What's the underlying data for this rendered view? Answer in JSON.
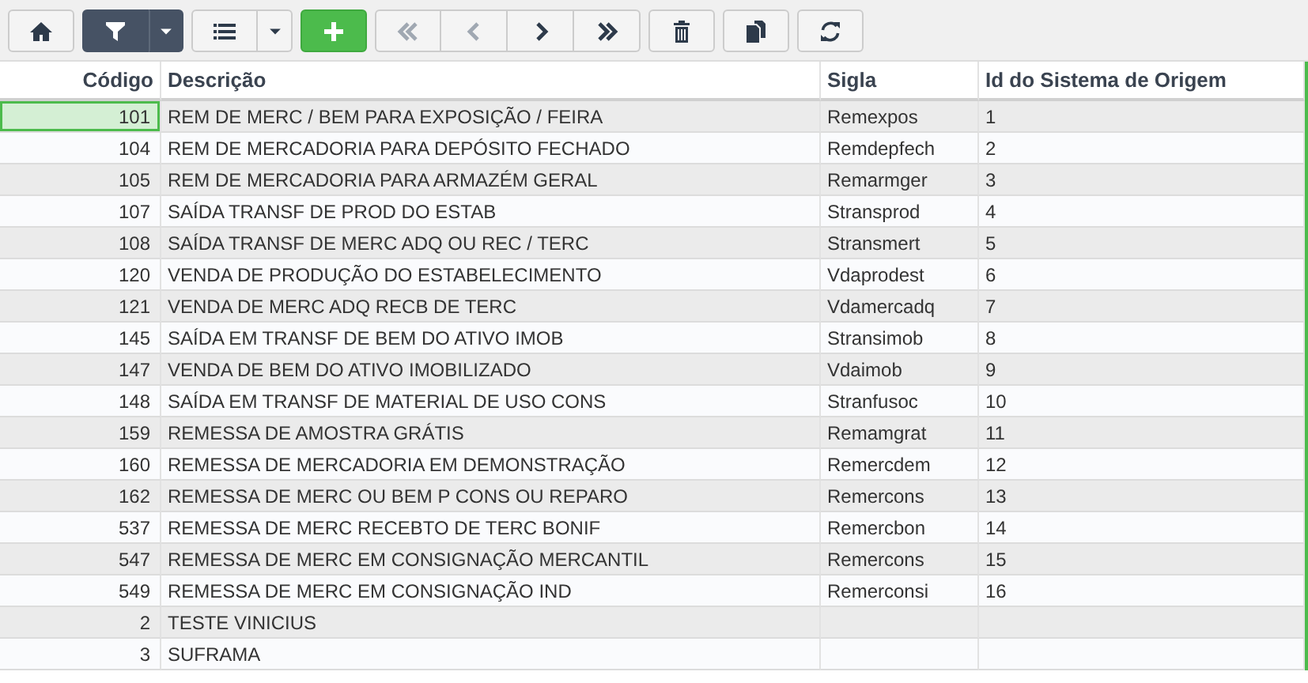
{
  "toolbar": [
    {
      "kind": "home",
      "selected": false,
      "disabled": false,
      "dropdown": false
    },
    {
      "kind": "filter",
      "selected": true,
      "disabled": false,
      "dropdown": true
    },
    {
      "kind": "list",
      "selected": false,
      "disabled": false,
      "dropdown": true
    },
    {
      "kind": "add",
      "selected": false,
      "disabled": false,
      "dropdown": false
    },
    {
      "kind": "first",
      "selected": false,
      "disabled": true,
      "dropdown": false
    },
    {
      "kind": "prev",
      "selected": false,
      "disabled": true,
      "dropdown": false
    },
    {
      "kind": "next",
      "selected": false,
      "disabled": false,
      "dropdown": false
    },
    {
      "kind": "last",
      "selected": false,
      "disabled": false,
      "dropdown": false
    },
    {
      "kind": "delete",
      "selected": false,
      "disabled": false,
      "dropdown": false
    },
    {
      "kind": "copy",
      "selected": false,
      "disabled": false,
      "dropdown": false
    },
    {
      "kind": "refresh",
      "selected": false,
      "disabled": false,
      "dropdown": false
    }
  ],
  "table": {
    "columns": [
      "Código",
      "Descrição",
      "Sigla",
      "Id do Sistema de Origem"
    ],
    "rows": [
      {
        "code": "101",
        "description": "REM DE MERC / BEM PARA EXPOSIÇÃO / FEIRA",
        "sigla": "Remexpos",
        "origin_id": "1",
        "selected": true
      },
      {
        "code": "104",
        "description": "REM DE MERCADORIA PARA DEPÓSITO FECHADO",
        "sigla": "Remdepfech",
        "origin_id": "2",
        "selected": false
      },
      {
        "code": "105",
        "description": "REM DE MERCADORIA PARA ARMAZÉM GERAL",
        "sigla": "Remarmger",
        "origin_id": "3",
        "selected": false
      },
      {
        "code": "107",
        "description": "SAÍDA TRANSF DE PROD DO ESTAB",
        "sigla": "Stransprod",
        "origin_id": "4",
        "selected": false
      },
      {
        "code": "108",
        "description": "SAÍDA TRANSF DE MERC ADQ OU REC / TERC",
        "sigla": "Stransmert",
        "origin_id": "5",
        "selected": false
      },
      {
        "code": "120",
        "description": "VENDA DE PRODUÇÃO DO ESTABELECIMENTO",
        "sigla": "Vdaprodest",
        "origin_id": "6",
        "selected": false
      },
      {
        "code": "121",
        "description": "VENDA DE MERC ADQ RECB DE TERC",
        "sigla": "Vdamercadq",
        "origin_id": "7",
        "selected": false
      },
      {
        "code": "145",
        "description": "SAÍDA EM TRANSF DE BEM DO ATIVO IMOB",
        "sigla": "Stransimob",
        "origin_id": "8",
        "selected": false
      },
      {
        "code": "147",
        "description": "VENDA DE BEM DO ATIVO IMOBILIZADO",
        "sigla": "Vdaimob",
        "origin_id": "9",
        "selected": false
      },
      {
        "code": "148",
        "description": "SAÍDA EM TRANSF DE MATERIAL DE USO CONS",
        "sigla": "Stranfusoc",
        "origin_id": "10",
        "selected": false
      },
      {
        "code": "159",
        "description": "REMESSA DE AMOSTRA GRÁTIS",
        "sigla": "Remamgrat",
        "origin_id": "11",
        "selected": false
      },
      {
        "code": "160",
        "description": "REMESSA DE MERCADORIA EM DEMONSTRAÇÃO",
        "sigla": "Remercdem",
        "origin_id": "12",
        "selected": false
      },
      {
        "code": "162",
        "description": "REMESSA DE MERC OU BEM P CONS OU REPARO",
        "sigla": "Remercons",
        "origin_id": "13",
        "selected": false
      },
      {
        "code": "537",
        "description": "REMESSA DE MERC RECEBTO DE TERC BONIF",
        "sigla": "Remercbon",
        "origin_id": "14",
        "selected": false
      },
      {
        "code": "547",
        "description": "REMESSA DE MERC EM CONSIGNAÇÃO MERCANTIL",
        "sigla": "Remercons",
        "origin_id": "15",
        "selected": false
      },
      {
        "code": "549",
        "description": "REMESSA DE MERC EM CONSIGNAÇÃO IND",
        "sigla": "Remerconsi",
        "origin_id": "16",
        "selected": false
      },
      {
        "code": "2",
        "description": "TESTE VINICIUS",
        "selected": false
      },
      {
        "code": "3",
        "description": "SUFRAMA",
        "selected": false
      }
    ]
  }
}
